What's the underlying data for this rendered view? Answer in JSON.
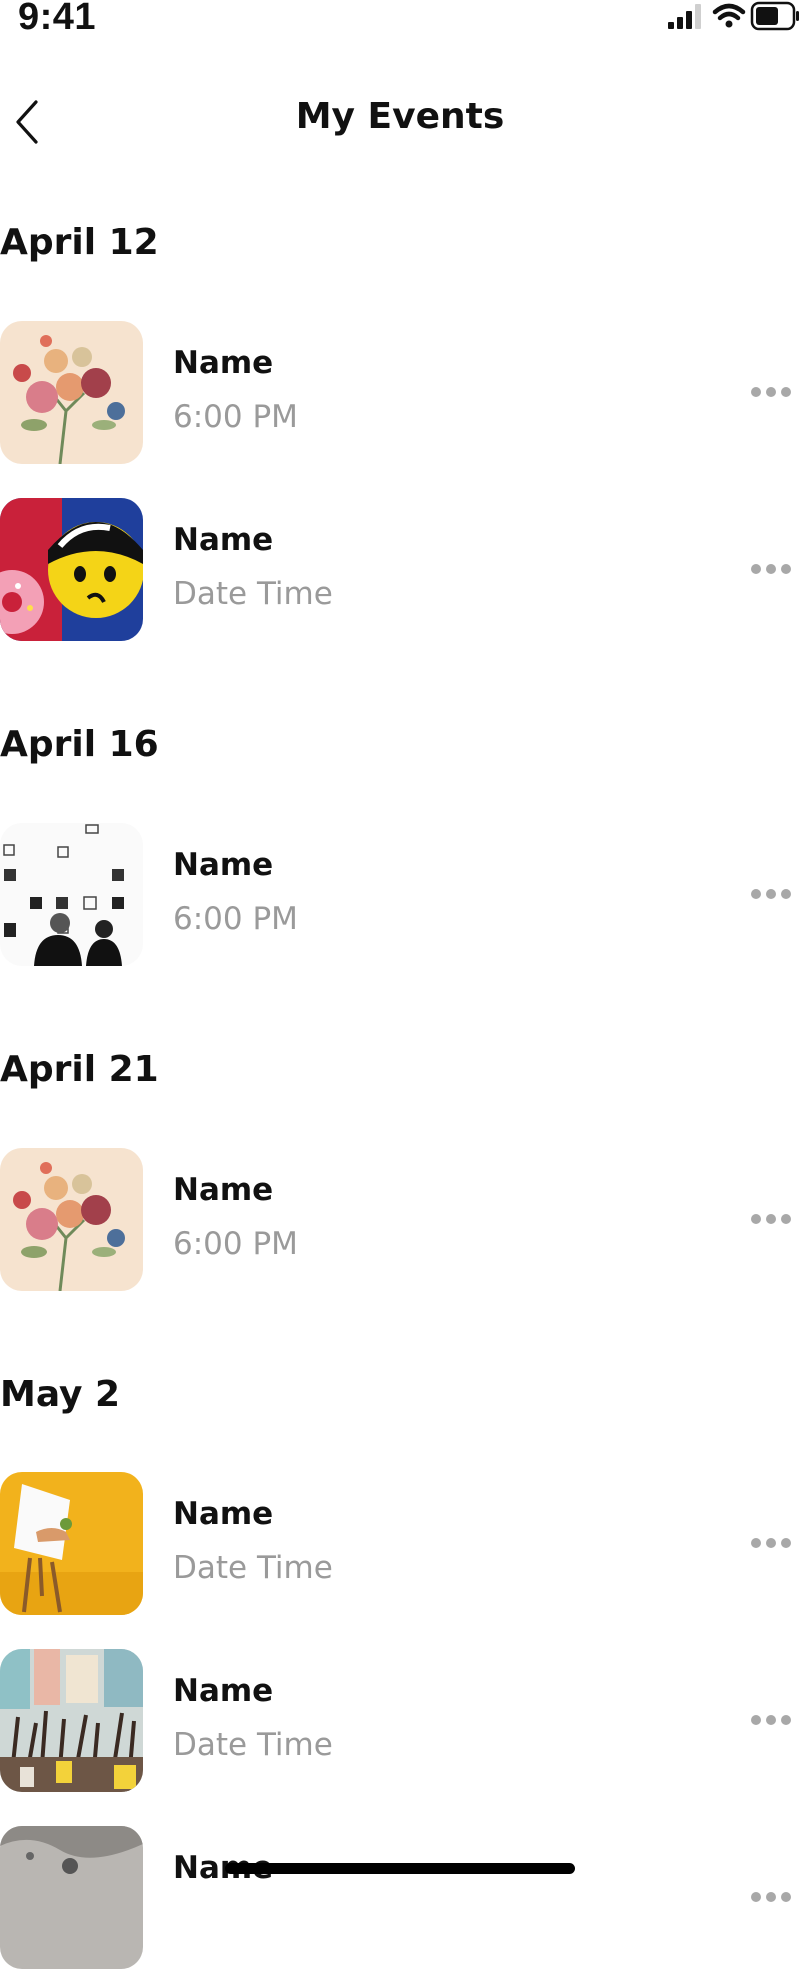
{
  "status_bar": {
    "time": "9:41",
    "icons": [
      "cellular-signal-icon",
      "wifi-icon",
      "battery-icon"
    ]
  },
  "header": {
    "title": "My Events",
    "back_icon": "chevron-left-icon"
  },
  "sections": [
    {
      "date": "April 12",
      "events": [
        {
          "name": "Name",
          "time": "6:00 PM",
          "image": "flower-bouquet-illustration"
        },
        {
          "name": "Name",
          "time": "Date Time",
          "image": "cartoon-character-with-donut"
        }
      ]
    },
    {
      "date": "April 16",
      "events": [
        {
          "name": "Name",
          "time": "6:00 PM",
          "image": "art-gallery-visitors"
        }
      ]
    },
    {
      "date": "April 21",
      "events": [
        {
          "name": "Name",
          "time": "6:00 PM",
          "image": "flower-bouquet-illustration"
        }
      ]
    },
    {
      "date": "May 2",
      "events": [
        {
          "name": "Name",
          "time": "Date Time",
          "image": "easel-on-yellow-background"
        },
        {
          "name": "Name",
          "time": "Date Time",
          "image": "paint-brushes-in-studio"
        },
        {
          "name": "Name",
          "time": "",
          "image": "grey-texture-artwork"
        }
      ]
    }
  ],
  "more_icon": "more-horizontal-icon",
  "colors": {
    "background": "#ffffff",
    "text_primary": "#111111",
    "text_secondary": "#9a9a9a",
    "more_dots": "#a8a8a8"
  }
}
